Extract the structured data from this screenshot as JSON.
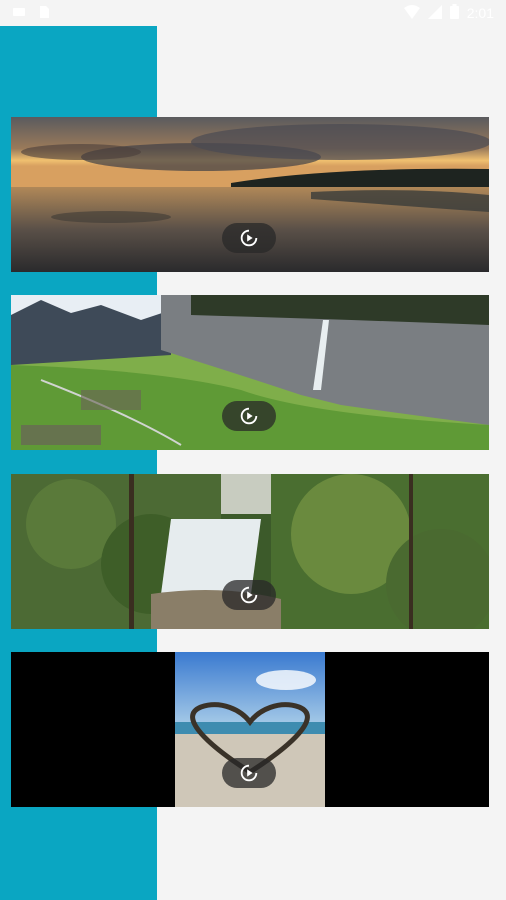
{
  "status_bar": {
    "time": "2:01",
    "icons": [
      "notification-icon",
      "sim-icon",
      "wifi-icon",
      "signal-icon",
      "battery-icon"
    ]
  },
  "colors": {
    "accent": "#0aa6c2",
    "background": "#f4f4f4",
    "play_button": "#2b2b2b"
  },
  "videos": [
    {
      "name": "sunset-lake-thumbnail",
      "icon": "replay-play-icon"
    },
    {
      "name": "valley-waterfall-thumbnail",
      "icon": "replay-play-icon"
    },
    {
      "name": "forest-waterfall-thumbnail",
      "icon": "replay-play-icon"
    },
    {
      "name": "beach-heart-thumbnail",
      "icon": "replay-play-icon"
    }
  ]
}
